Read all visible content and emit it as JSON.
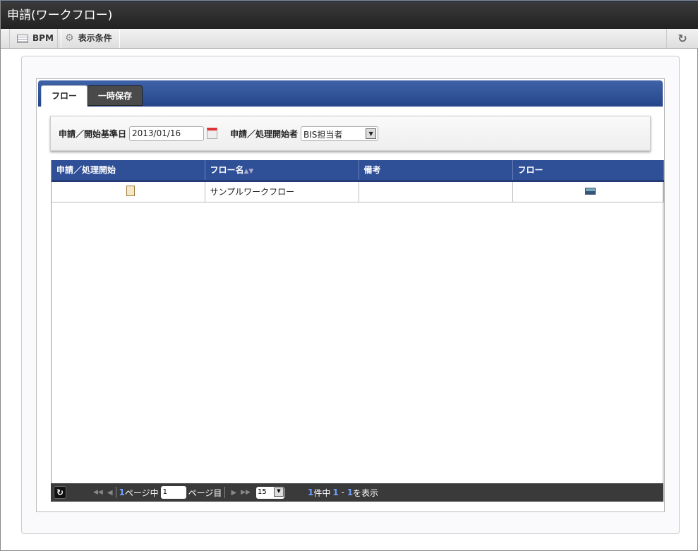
{
  "window": {
    "title": "申請(ワークフロー)"
  },
  "toolbar": {
    "bpm": "BPM",
    "display_conditions": "表示条件"
  },
  "tabs": [
    {
      "label": "フロー"
    },
    {
      "label": "一時保存"
    }
  ],
  "conditions": {
    "date_label": "申請／開始基準日",
    "date_value": "2013/01/16",
    "user_label": "申請／処理開始者",
    "user_value": "BIS担当者"
  },
  "table": {
    "headers": [
      "申請／処理開始",
      "フロー名",
      "備考",
      "フロー"
    ],
    "rows": [
      {
        "name": "サンプルワークフロー",
        "note": ""
      }
    ]
  },
  "pager": {
    "total_pages": "1",
    "page_of_label": "ページ中",
    "current_page": "1",
    "page_label": "ページ目",
    "page_size": "15",
    "total": "1",
    "total_label": "件中",
    "from": "1",
    "dash": " - ",
    "to": "1",
    "display_label": "を表示"
  }
}
